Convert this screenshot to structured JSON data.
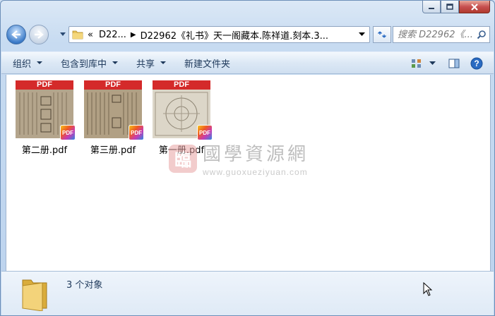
{
  "window": {
    "caption_buttons": [
      "minimize",
      "maximize",
      "close"
    ]
  },
  "address_bar": {
    "overflow_chevron": "«",
    "crumbs": [
      "D22...",
      "D22962《礼书》天一阁藏本.陈祥道.刻本.3..."
    ]
  },
  "search": {
    "placeholder": "搜索 D22962《..."
  },
  "toolbar": {
    "organize": "组织",
    "include_in_library": "包含到库中",
    "share": "共享",
    "new_folder": "新建文件夹"
  },
  "files": [
    {
      "name": "第二册.pdf",
      "band": "PDF",
      "badge": "PDF"
    },
    {
      "name": "第三册.pdf",
      "band": "PDF",
      "badge": "PDF"
    },
    {
      "name": "第一册.pdf",
      "band": "PDF",
      "badge": "PDF"
    }
  ],
  "watermark": {
    "seal": "臨",
    "name": "國學資源網",
    "url": "www.guoxueziyuan.com"
  },
  "status": {
    "item_count": "3 个对象"
  },
  "colors": {
    "pdf_band": "#d42a2a",
    "chrome_blue": "#c7dbf1",
    "text": "#1e395b"
  }
}
